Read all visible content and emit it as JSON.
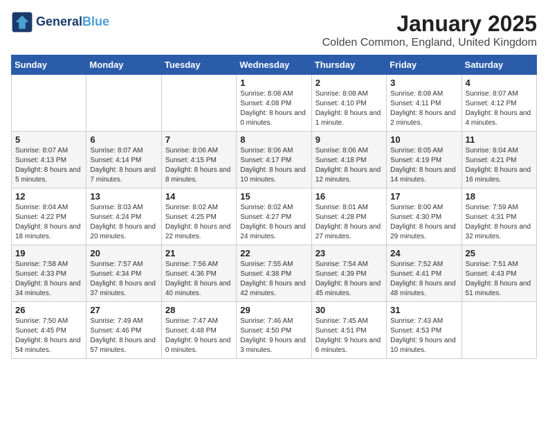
{
  "logo": {
    "line1": "General",
    "line2": "Blue"
  },
  "title": "January 2025",
  "subtitle": "Colden Common, England, United Kingdom",
  "days_of_week": [
    "Sunday",
    "Monday",
    "Tuesday",
    "Wednesday",
    "Thursday",
    "Friday",
    "Saturday"
  ],
  "weeks": [
    [
      {
        "day": "",
        "info": ""
      },
      {
        "day": "",
        "info": ""
      },
      {
        "day": "",
        "info": ""
      },
      {
        "day": "1",
        "info": "Sunrise: 8:08 AM\nSunset: 4:08 PM\nDaylight: 8 hours\nand 0 minutes."
      },
      {
        "day": "2",
        "info": "Sunrise: 8:08 AM\nSunset: 4:10 PM\nDaylight: 8 hours\nand 1 minute."
      },
      {
        "day": "3",
        "info": "Sunrise: 8:08 AM\nSunset: 4:11 PM\nDaylight: 8 hours\nand 2 minutes."
      },
      {
        "day": "4",
        "info": "Sunrise: 8:07 AM\nSunset: 4:12 PM\nDaylight: 8 hours\nand 4 minutes."
      }
    ],
    [
      {
        "day": "5",
        "info": "Sunrise: 8:07 AM\nSunset: 4:13 PM\nDaylight: 8 hours\nand 5 minutes."
      },
      {
        "day": "6",
        "info": "Sunrise: 8:07 AM\nSunset: 4:14 PM\nDaylight: 8 hours\nand 7 minutes."
      },
      {
        "day": "7",
        "info": "Sunrise: 8:06 AM\nSunset: 4:15 PM\nDaylight: 8 hours\nand 8 minutes."
      },
      {
        "day": "8",
        "info": "Sunrise: 8:06 AM\nSunset: 4:17 PM\nDaylight: 8 hours\nand 10 minutes."
      },
      {
        "day": "9",
        "info": "Sunrise: 8:06 AM\nSunset: 4:18 PM\nDaylight: 8 hours\nand 12 minutes."
      },
      {
        "day": "10",
        "info": "Sunrise: 8:05 AM\nSunset: 4:19 PM\nDaylight: 8 hours\nand 14 minutes."
      },
      {
        "day": "11",
        "info": "Sunrise: 8:04 AM\nSunset: 4:21 PM\nDaylight: 8 hours\nand 16 minutes."
      }
    ],
    [
      {
        "day": "12",
        "info": "Sunrise: 8:04 AM\nSunset: 4:22 PM\nDaylight: 8 hours\nand 18 minutes."
      },
      {
        "day": "13",
        "info": "Sunrise: 8:03 AM\nSunset: 4:24 PM\nDaylight: 8 hours\nand 20 minutes."
      },
      {
        "day": "14",
        "info": "Sunrise: 8:02 AM\nSunset: 4:25 PM\nDaylight: 8 hours\nand 22 minutes."
      },
      {
        "day": "15",
        "info": "Sunrise: 8:02 AM\nSunset: 4:27 PM\nDaylight: 8 hours\nand 24 minutes."
      },
      {
        "day": "16",
        "info": "Sunrise: 8:01 AM\nSunset: 4:28 PM\nDaylight: 8 hours\nand 27 minutes."
      },
      {
        "day": "17",
        "info": "Sunrise: 8:00 AM\nSunset: 4:30 PM\nDaylight: 8 hours\nand 29 minutes."
      },
      {
        "day": "18",
        "info": "Sunrise: 7:59 AM\nSunset: 4:31 PM\nDaylight: 8 hours\nand 32 minutes."
      }
    ],
    [
      {
        "day": "19",
        "info": "Sunrise: 7:58 AM\nSunset: 4:33 PM\nDaylight: 8 hours\nand 34 minutes."
      },
      {
        "day": "20",
        "info": "Sunrise: 7:57 AM\nSunset: 4:34 PM\nDaylight: 8 hours\nand 37 minutes."
      },
      {
        "day": "21",
        "info": "Sunrise: 7:56 AM\nSunset: 4:36 PM\nDaylight: 8 hours\nand 40 minutes."
      },
      {
        "day": "22",
        "info": "Sunrise: 7:55 AM\nSunset: 4:38 PM\nDaylight: 8 hours\nand 42 minutes."
      },
      {
        "day": "23",
        "info": "Sunrise: 7:54 AM\nSunset: 4:39 PM\nDaylight: 8 hours\nand 45 minutes."
      },
      {
        "day": "24",
        "info": "Sunrise: 7:52 AM\nSunset: 4:41 PM\nDaylight: 8 hours\nand 48 minutes."
      },
      {
        "day": "25",
        "info": "Sunrise: 7:51 AM\nSunset: 4:43 PM\nDaylight: 8 hours\nand 51 minutes."
      }
    ],
    [
      {
        "day": "26",
        "info": "Sunrise: 7:50 AM\nSunset: 4:45 PM\nDaylight: 8 hours\nand 54 minutes."
      },
      {
        "day": "27",
        "info": "Sunrise: 7:49 AM\nSunset: 4:46 PM\nDaylight: 8 hours\nand 57 minutes."
      },
      {
        "day": "28",
        "info": "Sunrise: 7:47 AM\nSunset: 4:48 PM\nDaylight: 9 hours\nand 0 minutes."
      },
      {
        "day": "29",
        "info": "Sunrise: 7:46 AM\nSunset: 4:50 PM\nDaylight: 9 hours\nand 3 minutes."
      },
      {
        "day": "30",
        "info": "Sunrise: 7:45 AM\nSunset: 4:51 PM\nDaylight: 9 hours\nand 6 minutes."
      },
      {
        "day": "31",
        "info": "Sunrise: 7:43 AM\nSunset: 4:53 PM\nDaylight: 9 hours\nand 10 minutes."
      },
      {
        "day": "",
        "info": ""
      }
    ]
  ]
}
